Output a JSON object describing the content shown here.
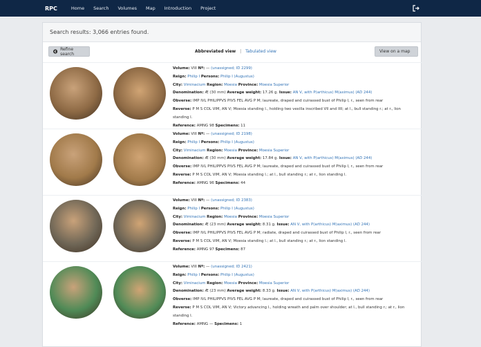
{
  "nav": {
    "brand": "RPC",
    "items": [
      "Home",
      "Search",
      "Volumes",
      "Map",
      "Introduction",
      "Project"
    ]
  },
  "results": {
    "summary": "Search results: 3,066 entries found."
  },
  "controls": {
    "refine": "Refine search",
    "abbreviated": "Abbreviated view",
    "separator": "|",
    "tabulated": "Tabulated view",
    "map": "View on a map"
  },
  "labels": {
    "volume": "Volume:",
    "no": "Nº:",
    "reign": "Reign:",
    "persons": "Persons:",
    "city": "City:",
    "region": "Region:",
    "province": "Province:",
    "denomination": "Denomination:",
    "weight": "Average weight:",
    "issue": "Issue:",
    "obverse": "Obverse:",
    "reverse": "Reverse:",
    "reference": "Reference:",
    "specimens": "Specimens:"
  },
  "records": [
    {
      "volume": "VIII",
      "no": "—",
      "assigned": "(unassigned; ID 2299)",
      "reign": "Philip I",
      "persons": "Philip I (Augustus)",
      "city": "Viminacium",
      "region": "Moesia",
      "province": "Moesia Superior",
      "denomination": "Æ (30 mm)",
      "weight": "17.26 g.",
      "issue": "AN V, with P(arthicus) M(aximus) (AD 244)",
      "obverse": "IMP IVL PHILIPPVS PIVS FEL AVG P M; laureate, draped and cuirassed bust of Philip I, r., seen from rear",
      "reverse": "P M S COL VIM, AN V; Moesia standing l., holding two vexilla inscribed VII and IIII; at l., bull standing r.; at r., lion standing l.",
      "reference": "AMNG 98",
      "specimens": "11"
    },
    {
      "volume": "VIII",
      "no": "—",
      "assigned": "(unassigned; ID 2198)",
      "reign": "Philip I",
      "persons": "Philip I (Augustus)",
      "city": "Viminacium",
      "region": "Moesia",
      "province": "Moesia Superior",
      "denomination": "Æ (30 mm)",
      "weight": "17.84 g.",
      "issue": "AN V, with P(arthicus) M(aximus) (AD 244)",
      "obverse": "IMP IVL PHILIPPVS PIVS FEL AVG P M; laureate, draped and cuirassed bust of Philip I, r., seen from rear",
      "reverse": "P M S COL VIM, AN V; Moesia standing l.; at l., bull standing r.; at r., lion standing l.",
      "reference": "AMNG 96",
      "specimens": "44"
    },
    {
      "volume": "VIII",
      "no": "—",
      "assigned": "(unassigned; ID 2383)",
      "reign": "Philip I",
      "persons": "Philip I (Augustus)",
      "city": "Viminacium",
      "region": "Moesia",
      "province": "Moesia Superior",
      "denomination": "Æ (23 mm)",
      "weight": "8.31 g.",
      "issue": "AN V, with P(arthicus) M(aximus) (AD 244)",
      "obverse": "IMP IVL PHILIPPVS PIVS FEL AVG P M; radiate, draped and cuirassed bust of Philip I, r., seen from rear",
      "reverse": "P M S COL VIM, AN V; Moesia standing l.; at l., bull standing r.; at r., lion standing l.",
      "reference": "AMNG 97",
      "specimens": "87"
    },
    {
      "volume": "VIII",
      "no": "—",
      "assigned": "(unassigned; ID 2421)",
      "reign": "Philip I",
      "persons": "Philip I (Augustus)",
      "city": "Viminacium",
      "region": "Moesia",
      "province": "Moesia Superior",
      "denomination": "Æ (23 mm)",
      "weight": "8.33 g.",
      "issue": "AN V, with P(arthicus) M(aximus) (AD 244)",
      "obverse": "IMP IVL PHILIPPVS PIVS FEL AVG P M; laureate, draped and cuirassed bust of Philip I, r., seen from rear",
      "reverse": "P M S COL VIM, AN V; Victory advancing l., holding wreath and palm over shoulder; at l., bull standing r.; at r., lion standing l.",
      "reference": "AMNG —",
      "specimens": "1"
    }
  ],
  "coin_colors": [
    "#8e6a45",
    "#a17a4a",
    "#6f6656",
    "#4f8a56"
  ],
  "icons": {
    "logout": "sign-out-icon",
    "refine": "circle-left-icon"
  }
}
